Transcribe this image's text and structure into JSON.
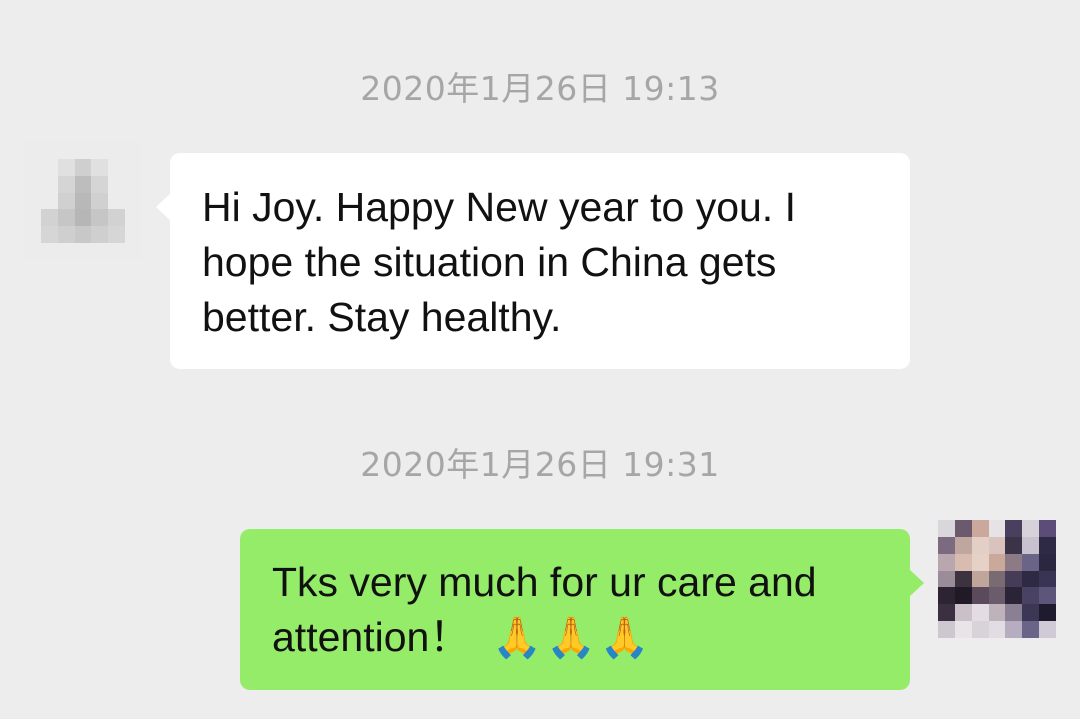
{
  "messages": [
    {
      "timestamp": "2020年1月26日 19:13",
      "sender": "other",
      "text": "Hi Joy.  Happy New year to you.  I hope the situation in China gets better. Stay healthy."
    },
    {
      "timestamp": "2020年1月26日 19:31",
      "sender": "self",
      "text": "Tks very much for ur care and attention！",
      "emoji": "🙏🙏🙏"
    }
  ],
  "colors": {
    "background": "#ededed",
    "incoming_bubble": "#ffffff",
    "outgoing_bubble": "#95ec69",
    "timestamp_text": "#a6a6a6"
  },
  "icons": {
    "left_avatar": "pixelated-avatar-icon",
    "right_avatar": "pixelated-avatar-icon"
  }
}
